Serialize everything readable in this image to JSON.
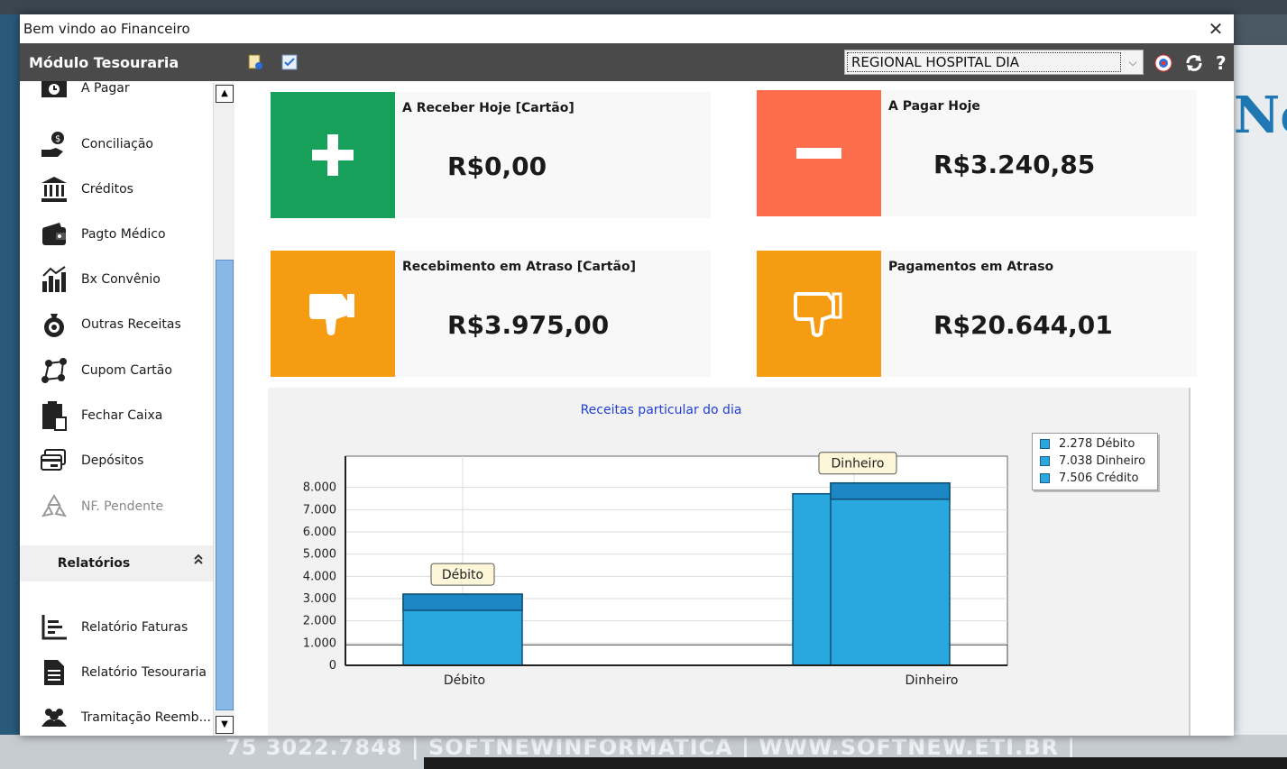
{
  "window": {
    "title": "Bem vindo ao Financeiro",
    "close_symbol": "✕"
  },
  "toolbar": {
    "module_title": "Módulo Tesouraria",
    "unit_select": {
      "selected": "REGIONAL HOSPITAL DIA"
    }
  },
  "sidebar": {
    "items": [
      {
        "label": "A Pagar",
        "icon": "clock-money-icon"
      },
      {
        "label": "Conciliação",
        "icon": "hand-coin-icon"
      },
      {
        "label": "Créditos",
        "icon": "bank-icon"
      },
      {
        "label": "Pagto Médico",
        "icon": "wallet-icon"
      },
      {
        "label": "Bx Convênio",
        "icon": "chart-bars-icon"
      },
      {
        "label": "Outras Receitas",
        "icon": "money-bag-icon"
      },
      {
        "label": "Cupom Cartão",
        "icon": "network-icon"
      },
      {
        "label": "Fechar Caixa",
        "icon": "clipboard-icon"
      },
      {
        "label": "Depósitos",
        "icon": "card-deposit-icon"
      },
      {
        "label": "NF. Pendente",
        "icon": "recycle-icon"
      }
    ],
    "reports": {
      "label": "Relatórios",
      "items": [
        {
          "label": "Relatório Faturas",
          "icon": "chart-line-icon"
        },
        {
          "label": "Relatório Tesouraria",
          "icon": "document-icon"
        },
        {
          "label": "Tramitação Reemb...",
          "icon": "people-icon"
        }
      ]
    }
  },
  "cards": {
    "receive_today": {
      "title": "A Receber Hoje [Cartão]",
      "value": "R$0,00",
      "color": "#16a05a"
    },
    "pay_today": {
      "title": "A Pagar Hoje",
      "value": "R$3.240,85",
      "color": "#fb6d4b"
    },
    "late_receipts": {
      "title": "Recebimento em Atraso [Cartão]",
      "value": "R$3.975,00",
      "color": "#f59c12"
    },
    "late_payments": {
      "title": "Pagamentos em Atraso",
      "value": "R$20.644,01",
      "color": "#f59c12"
    }
  },
  "chart_data": {
    "type": "bar",
    "title": "Receitas particular do dia",
    "categories": [
      "Débito",
      "Dinheiro"
    ],
    "bars": [
      {
        "category": "Débito",
        "value": 3200,
        "label": "Débito"
      },
      {
        "category": "Dinheiro",
        "value": 8200,
        "label": "Dinheiro"
      }
    ],
    "legend": [
      "2.278 Débito",
      "7.038 Dinheiro",
      "7.506 Crédito"
    ],
    "yticks": [
      "0",
      "1.000",
      "2.000",
      "3.000",
      "4.000",
      "5.000",
      "6.000",
      "7.000",
      "8.000"
    ],
    "ylim": [
      0,
      9000
    ],
    "grid": true,
    "legend_position": "top-right",
    "bar_color": "#29a8e0",
    "title_color": "#1f3fd6"
  },
  "desktop": {
    "bottom_text": "75 3022.7848 | SOFTNEWINFORMATICA | WWW.SOFTNEW.ETI.BR |",
    "right_logo": "Ne"
  }
}
